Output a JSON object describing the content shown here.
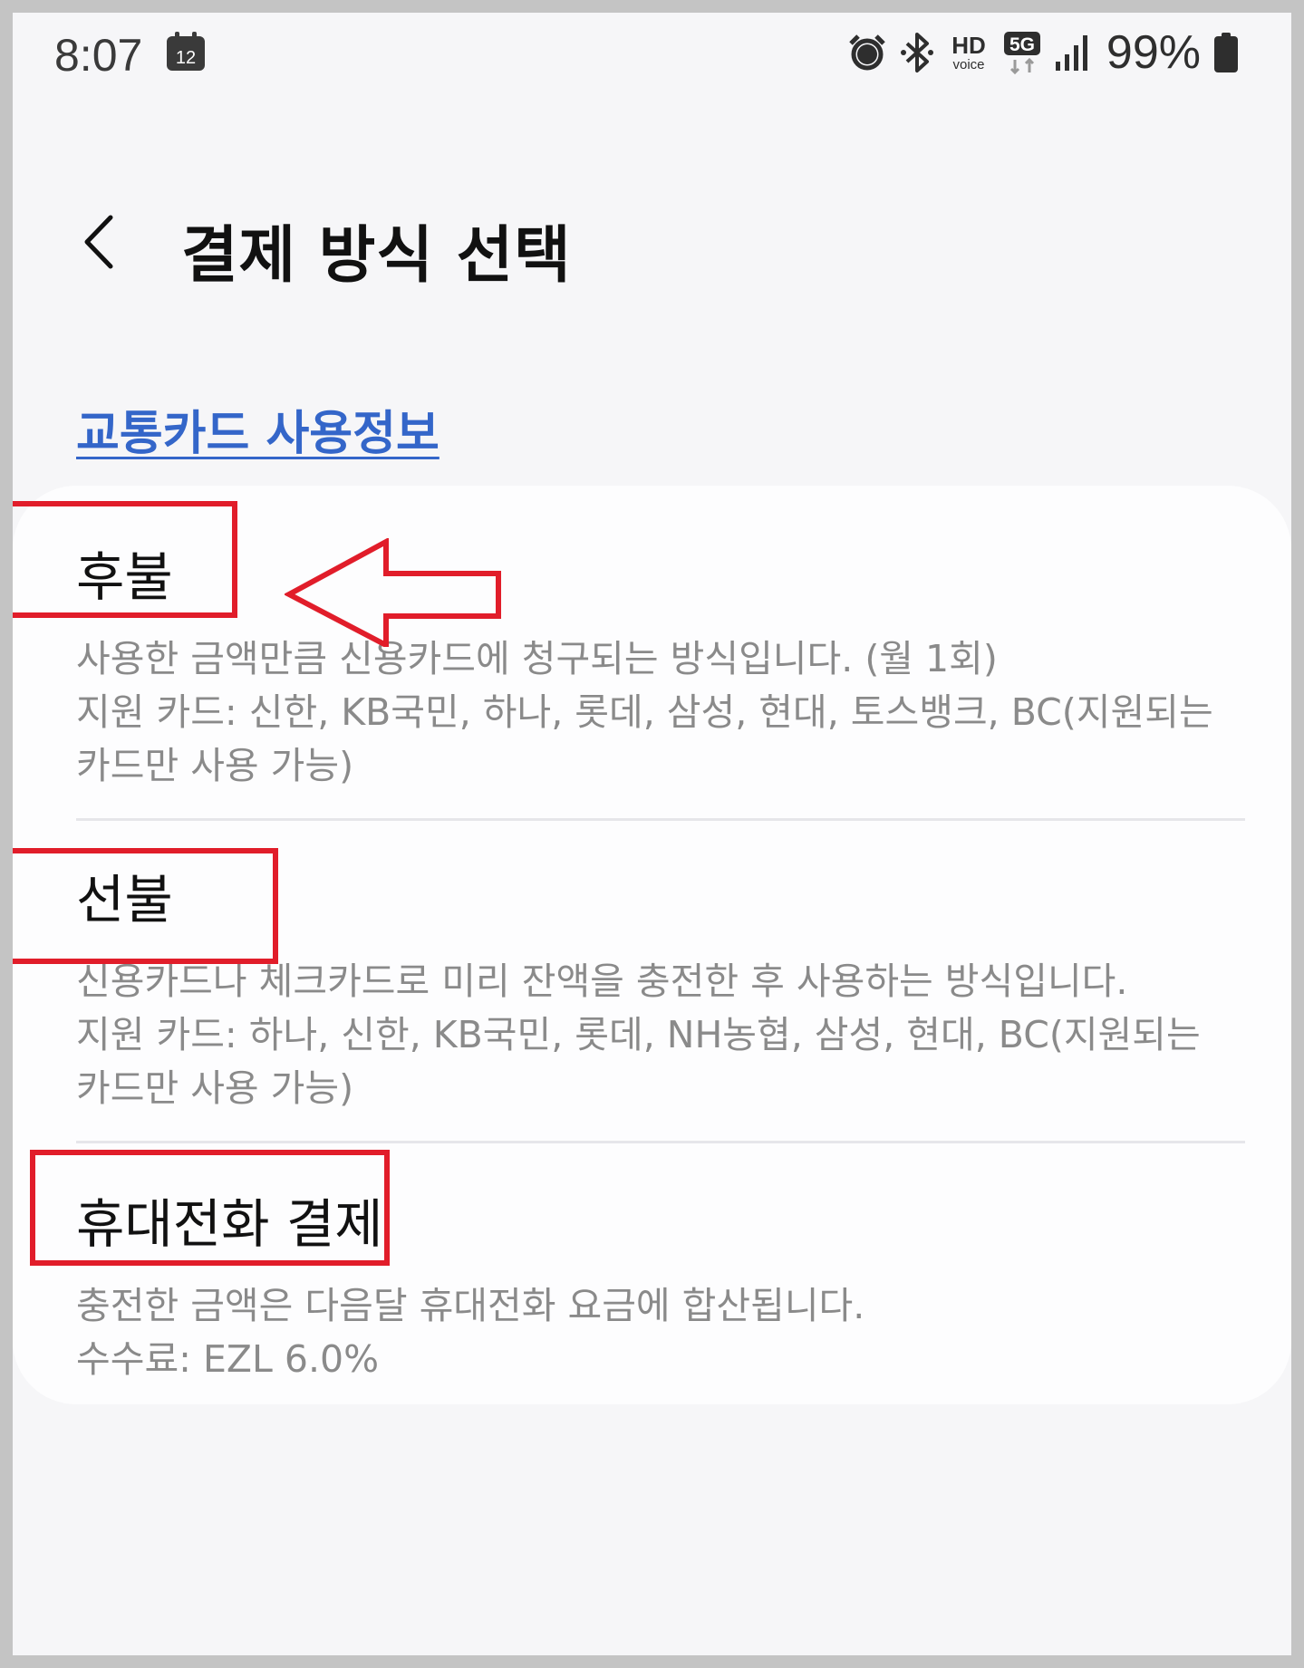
{
  "status_bar": {
    "time": "8:07",
    "calendar_day": "12",
    "hd_label": "HD",
    "voice_label": "voice",
    "network_label": "5G",
    "battery": "99%"
  },
  "header": {
    "title": "결제 방식 선택"
  },
  "info_link": "교통카드 사용정보",
  "options": [
    {
      "title": "후불",
      "description": "사용한 금액만큼 신용카드에 청구되는 방식입니다. (월 1회)\n지원 카드: 신한, KB국민, 하나, 롯데, 삼성, 현대, 토스뱅크, BC(지원되는 카드만 사용 가능)"
    },
    {
      "title": "선불",
      "description": "신용카드나 체크카드로 미리 잔액을 충전한 후 사용하는 방식입니다.\n지원 카드: 하나, 신한, KB국민, 롯데, NH농협, 삼성, 현대, BC(지원되는 카드만 사용 가능)"
    },
    {
      "title": "휴대전화 결제",
      "description": "충전한 금액은 다음달 휴대전화 요금에 합산됩니다.\n수수료: EZL 6.0%"
    }
  ],
  "colors": {
    "link": "#3466c9",
    "annotation": "#e11d2a",
    "secondary_text": "#8a8a8a"
  },
  "icons": [
    "calendar-icon",
    "alarm-icon",
    "bluetooth-icon",
    "hd-voice-icon",
    "5g-icon",
    "signal-icon",
    "battery-icon",
    "back-arrow-icon",
    "annotation-arrow-icon"
  ]
}
